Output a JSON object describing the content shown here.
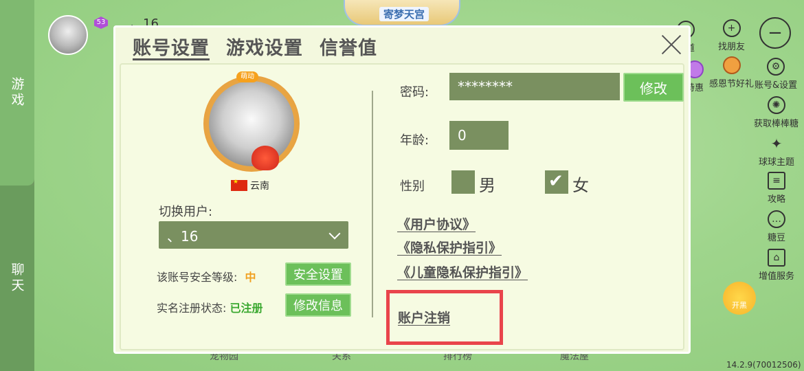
{
  "left_tabs": [
    "游戏",
    "聊天"
  ],
  "top": {
    "level": "53",
    "username": "、16",
    "banner": "寄梦天宫"
  },
  "right_menu": {
    "frequency": "频道",
    "find_friends": "找朋友",
    "preferential": "特惠",
    "thanksgiving": "感恩节好礼",
    "account_settings": "账号&设置",
    "get_candy": "获取棒棒糖",
    "ball_theme": "球球主题",
    "guide": "攻略",
    "candy_beans": "糖豆",
    "value_service": "增值服务",
    "kaihei": "开黑"
  },
  "version": "14.2.9(70012506)",
  "bottom_labels": [
    "宠物园",
    "关系",
    "排行榜",
    "魔法屋"
  ],
  "dialog": {
    "tabs": [
      "账号设置",
      "游戏设置",
      "信誉值"
    ],
    "frame_tag": "萌动",
    "region": "云南",
    "switch_user_label": "切换用户:",
    "current_user": "、16",
    "security_level_label": "该账号安全等级:",
    "security_level_value": "中",
    "security_button": "安全设置",
    "realname_label": "实名注册状态:",
    "realname_value": "已注册",
    "edit_info_button": "修改信息",
    "password_label": "密码:",
    "password_value": "********",
    "modify_button": "修改",
    "age_label": "年龄:",
    "age_value": "0",
    "gender_label": "性别",
    "male": "男",
    "female": "女",
    "links": [
      "《用户协议》",
      "《隐私保护指引》",
      "《儿童隐私保护指引》"
    ],
    "cancel_account": "账户注销"
  },
  "colors": {
    "highlight": "#e9444b",
    "field": "#7a9060",
    "button": "#6cc05a",
    "security_value": "#f0a020",
    "registered": "#3aa830"
  }
}
